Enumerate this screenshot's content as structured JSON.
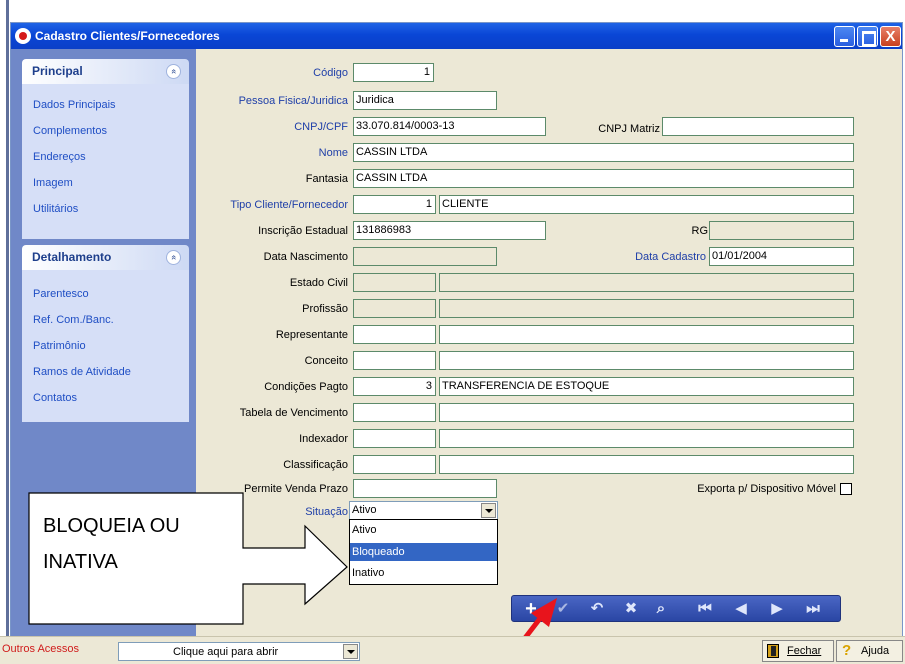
{
  "window": {
    "title": "Cadastro Clientes/Fornecedores",
    "close_glyph": "X"
  },
  "sidebar": {
    "panel1": {
      "title": "Principal",
      "toggle_glyph": "»",
      "items": [
        "Dados Principais",
        "Complementos",
        "Endereços",
        "Imagem",
        "Utilitários"
      ]
    },
    "panel2": {
      "title": "Detalhamento",
      "toggle_glyph": "»",
      "items": [
        "Parentesco",
        "Ref. Com./Banc.",
        "Patrimônio",
        "Ramos de Atividade",
        "Contatos"
      ]
    }
  },
  "form": {
    "codigo": {
      "label": "Código",
      "value": "1"
    },
    "pessoa": {
      "label": "Pessoa Fisica/Juridica",
      "value": "Juridica"
    },
    "cnpj": {
      "label": "CNPJ/CPF",
      "value": "33.070.814/0003-13"
    },
    "cnpj_matriz": {
      "label": "CNPJ Matriz",
      "value": ""
    },
    "nome": {
      "label": "Nome",
      "value": "CASSIN LTDA"
    },
    "fantasia": {
      "label": "Fantasia",
      "value": "CASSIN LTDA"
    },
    "tipo": {
      "label": "Tipo Cliente/Fornecedor",
      "code": "1",
      "desc": "CLIENTE"
    },
    "inscricao": {
      "label": "Inscrição Estadual",
      "value": "131886983"
    },
    "rg": {
      "label": "RG",
      "value": ""
    },
    "data_nasc": {
      "label": "Data Nascimento",
      "value": ""
    },
    "data_cad": {
      "label": "Data Cadastro",
      "value": "01/01/2004"
    },
    "estado_civil": {
      "label": "Estado Civil"
    },
    "profissao": {
      "label": "Profissão"
    },
    "representante": {
      "label": "Representante"
    },
    "conceito": {
      "label": "Conceito"
    },
    "condicoes": {
      "label": "Condições Pagto",
      "code": "3",
      "desc": "TRANSFERENCIA DE ESTOQUE"
    },
    "tabela": {
      "label": "Tabela de Vencimento"
    },
    "indexador": {
      "label": "Indexador"
    },
    "classificacao": {
      "label": "Classificação"
    },
    "permite": {
      "label": "Permite Venda  Prazo",
      "value": ""
    },
    "exporta": {
      "label": "Exporta p/ Dispositivo Móvel",
      "checked": false
    },
    "situacao": {
      "label": "Situação",
      "value": "Ativo",
      "options": [
        "Ativo",
        "Bloqueado",
        "Inativo"
      ],
      "highlighted": "Bloqueado"
    }
  },
  "annotation": {
    "line1": "BLOQUEIA OU",
    "line2": "INATIVA",
    "arrow_color": "#e8141c"
  },
  "toolbar": {
    "add": "+",
    "confirm": "✔",
    "undo": "↶",
    "delete": "✖",
    "search": "⌕",
    "first": "⏮",
    "prev": "◀",
    "next": "▶",
    "last": "⏭"
  },
  "status": {
    "outros": "Outros Acessos",
    "combo_text": "Clique aqui para abrir",
    "fechar": "Fechar",
    "ajuda": "Ajuda"
  }
}
